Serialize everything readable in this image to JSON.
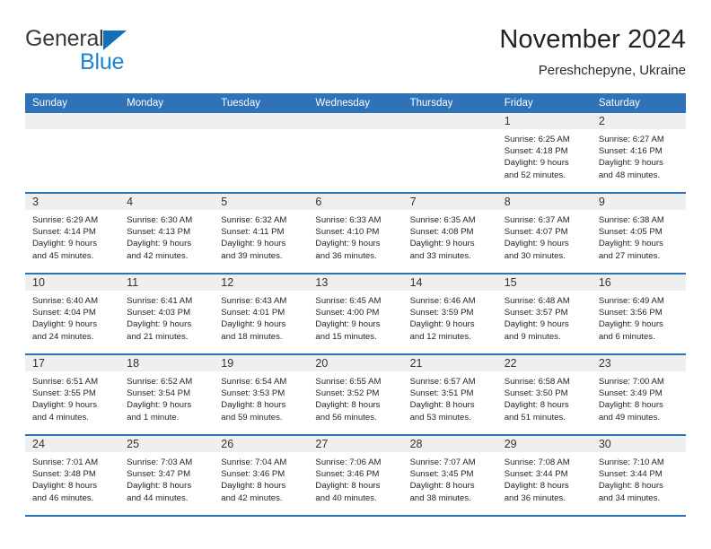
{
  "brand": {
    "word1": "General",
    "word2": "Blue",
    "triangle_color": "#1470b8",
    "word2_color": "#1a84d6"
  },
  "header": {
    "title": "November 2024",
    "subtitle": "Pereshchepyne, Ukraine"
  },
  "theme": {
    "header_blue": "#2E72B8",
    "daynum_band": "#efefef",
    "text": "#262626"
  },
  "weekday_headers": [
    "Sunday",
    "Monday",
    "Tuesday",
    "Wednesday",
    "Thursday",
    "Friday",
    "Saturday"
  ],
  "weeks": [
    [
      {
        "day": "",
        "info": ""
      },
      {
        "day": "",
        "info": ""
      },
      {
        "day": "",
        "info": ""
      },
      {
        "day": "",
        "info": ""
      },
      {
        "day": "",
        "info": ""
      },
      {
        "day": "1",
        "info": "Sunrise: 6:25 AM\nSunset: 4:18 PM\nDaylight: 9 hours\nand 52 minutes."
      },
      {
        "day": "2",
        "info": "Sunrise: 6:27 AM\nSunset: 4:16 PM\nDaylight: 9 hours\nand 48 minutes."
      }
    ],
    [
      {
        "day": "3",
        "info": "Sunrise: 6:29 AM\nSunset: 4:14 PM\nDaylight: 9 hours\nand 45 minutes."
      },
      {
        "day": "4",
        "info": "Sunrise: 6:30 AM\nSunset: 4:13 PM\nDaylight: 9 hours\nand 42 minutes."
      },
      {
        "day": "5",
        "info": "Sunrise: 6:32 AM\nSunset: 4:11 PM\nDaylight: 9 hours\nand 39 minutes."
      },
      {
        "day": "6",
        "info": "Sunrise: 6:33 AM\nSunset: 4:10 PM\nDaylight: 9 hours\nand 36 minutes."
      },
      {
        "day": "7",
        "info": "Sunrise: 6:35 AM\nSunset: 4:08 PM\nDaylight: 9 hours\nand 33 minutes."
      },
      {
        "day": "8",
        "info": "Sunrise: 6:37 AM\nSunset: 4:07 PM\nDaylight: 9 hours\nand 30 minutes."
      },
      {
        "day": "9",
        "info": "Sunrise: 6:38 AM\nSunset: 4:05 PM\nDaylight: 9 hours\nand 27 minutes."
      }
    ],
    [
      {
        "day": "10",
        "info": "Sunrise: 6:40 AM\nSunset: 4:04 PM\nDaylight: 9 hours\nand 24 minutes."
      },
      {
        "day": "11",
        "info": "Sunrise: 6:41 AM\nSunset: 4:03 PM\nDaylight: 9 hours\nand 21 minutes."
      },
      {
        "day": "12",
        "info": "Sunrise: 6:43 AM\nSunset: 4:01 PM\nDaylight: 9 hours\nand 18 minutes."
      },
      {
        "day": "13",
        "info": "Sunrise: 6:45 AM\nSunset: 4:00 PM\nDaylight: 9 hours\nand 15 minutes."
      },
      {
        "day": "14",
        "info": "Sunrise: 6:46 AM\nSunset: 3:59 PM\nDaylight: 9 hours\nand 12 minutes."
      },
      {
        "day": "15",
        "info": "Sunrise: 6:48 AM\nSunset: 3:57 PM\nDaylight: 9 hours\nand 9 minutes."
      },
      {
        "day": "16",
        "info": "Sunrise: 6:49 AM\nSunset: 3:56 PM\nDaylight: 9 hours\nand 6 minutes."
      }
    ],
    [
      {
        "day": "17",
        "info": "Sunrise: 6:51 AM\nSunset: 3:55 PM\nDaylight: 9 hours\nand 4 minutes."
      },
      {
        "day": "18",
        "info": "Sunrise: 6:52 AM\nSunset: 3:54 PM\nDaylight: 9 hours\nand 1 minute."
      },
      {
        "day": "19",
        "info": "Sunrise: 6:54 AM\nSunset: 3:53 PM\nDaylight: 8 hours\nand 59 minutes."
      },
      {
        "day": "20",
        "info": "Sunrise: 6:55 AM\nSunset: 3:52 PM\nDaylight: 8 hours\nand 56 minutes."
      },
      {
        "day": "21",
        "info": "Sunrise: 6:57 AM\nSunset: 3:51 PM\nDaylight: 8 hours\nand 53 minutes."
      },
      {
        "day": "22",
        "info": "Sunrise: 6:58 AM\nSunset: 3:50 PM\nDaylight: 8 hours\nand 51 minutes."
      },
      {
        "day": "23",
        "info": "Sunrise: 7:00 AM\nSunset: 3:49 PM\nDaylight: 8 hours\nand 49 minutes."
      }
    ],
    [
      {
        "day": "24",
        "info": "Sunrise: 7:01 AM\nSunset: 3:48 PM\nDaylight: 8 hours\nand 46 minutes."
      },
      {
        "day": "25",
        "info": "Sunrise: 7:03 AM\nSunset: 3:47 PM\nDaylight: 8 hours\nand 44 minutes."
      },
      {
        "day": "26",
        "info": "Sunrise: 7:04 AM\nSunset: 3:46 PM\nDaylight: 8 hours\nand 42 minutes."
      },
      {
        "day": "27",
        "info": "Sunrise: 7:06 AM\nSunset: 3:46 PM\nDaylight: 8 hours\nand 40 minutes."
      },
      {
        "day": "28",
        "info": "Sunrise: 7:07 AM\nSunset: 3:45 PM\nDaylight: 8 hours\nand 38 minutes."
      },
      {
        "day": "29",
        "info": "Sunrise: 7:08 AM\nSunset: 3:44 PM\nDaylight: 8 hours\nand 36 minutes."
      },
      {
        "day": "30",
        "info": "Sunrise: 7:10 AM\nSunset: 3:44 PM\nDaylight: 8 hours\nand 34 minutes."
      }
    ]
  ]
}
